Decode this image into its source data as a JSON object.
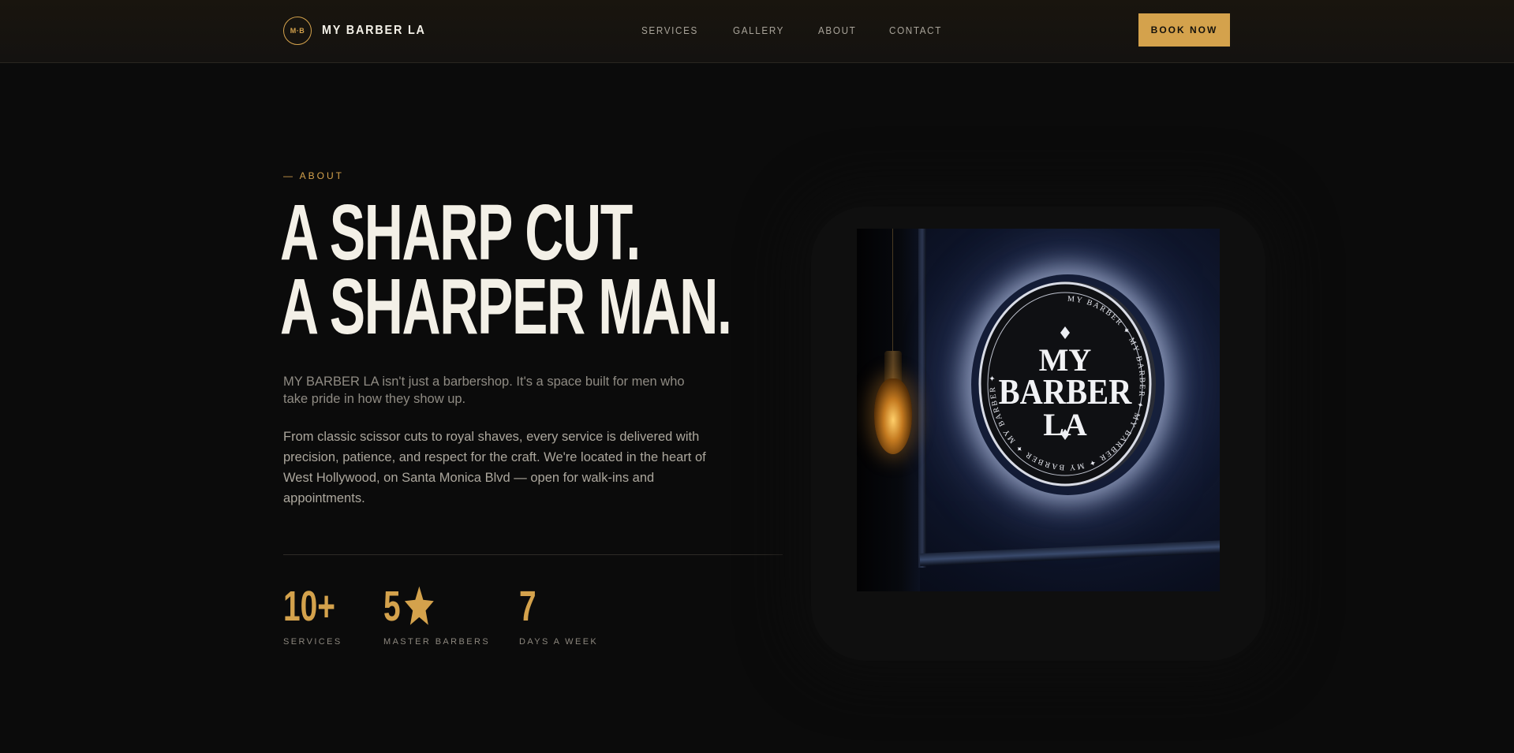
{
  "nav": {
    "logo_monogram": "M·B",
    "brand": "MY BARBER LA",
    "links": [
      "SERVICES",
      "GALLERY",
      "ABOUT",
      "CONTACT"
    ],
    "cta": "BOOK NOW"
  },
  "hero": {
    "eyebrow": "— ABOUT",
    "headline": [
      "A SHARP CUT.",
      "A SHARPER MAN."
    ],
    "lead": "MY BARBER LA isn't just a barbershop. It's a space built for men who take pride in how they show up.",
    "body": "From classic scissor cuts to royal shaves, every service is delivered with precision, patience, and respect for the craft. We're located in the heart of West Hollywood, on Santa Monica Blvd — open for walk-ins and appointments."
  },
  "stats": [
    {
      "value": "10+",
      "label": "SERVICES"
    },
    {
      "value": "5",
      "icon": "star-icon",
      "label": "MASTER BARBERS"
    },
    {
      "value": "7",
      "label": "DAYS A WEEK"
    }
  ],
  "photo": {
    "sign_lines": [
      "MY",
      "BARBER",
      "LA"
    ],
    "sign_ring_text": "MY BARBER ✦ MY BARBER ✦ MY BARBER ✦ MY BARBER ✦ MY BARBER ✦"
  },
  "colors": {
    "accent": "#d4a24c",
    "background": "#0b0b0b",
    "headline": "#f3f0e7"
  }
}
